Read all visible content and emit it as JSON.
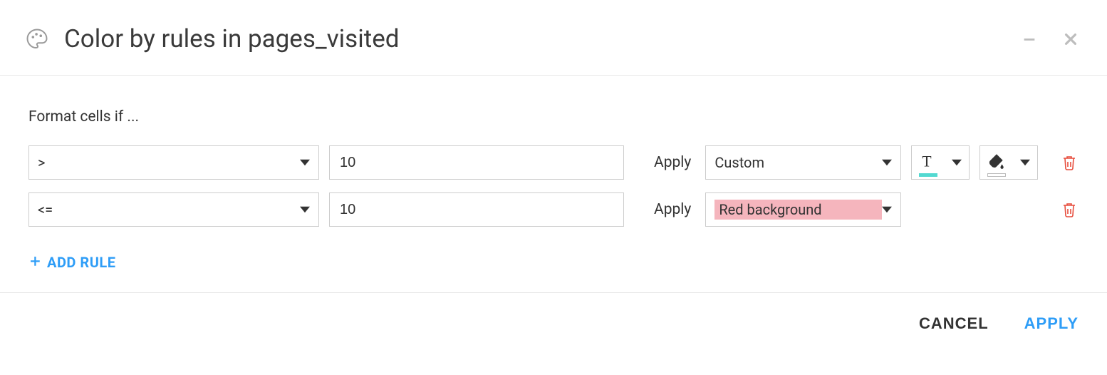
{
  "header": {
    "title": "Color by rules in pages_visited"
  },
  "body": {
    "prompt": "Format cells if ...",
    "apply_label": "Apply",
    "add_rule_label": "ADD RULE",
    "rules": [
      {
        "operator": ">",
        "value": "10",
        "style": "Custom",
        "style_highlight": false,
        "has_pickers": true
      },
      {
        "operator": "<=",
        "value": "10",
        "style": "Red background",
        "style_highlight": true,
        "has_pickers": false
      }
    ]
  },
  "footer": {
    "cancel": "CANCEL",
    "apply": "APPLY"
  },
  "colors": {
    "text_color_swatch": "#53d9d1",
    "fill_color_swatch": "#ffffff"
  }
}
